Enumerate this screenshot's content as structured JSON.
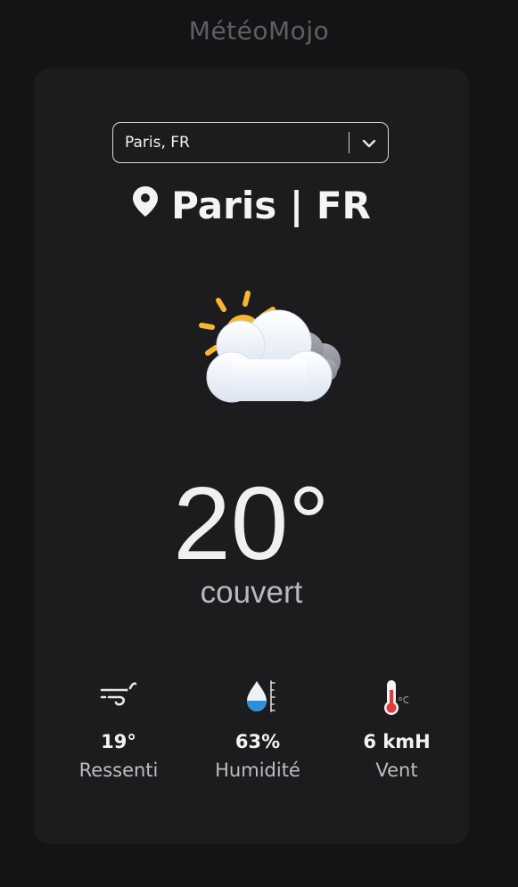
{
  "app": {
    "title": "MétéoMojo"
  },
  "city_select": {
    "value": "Paris, FR"
  },
  "location": {
    "text": "Paris | FR"
  },
  "current": {
    "temperature": "20°",
    "description": "couvert",
    "icon": "sun-behind-clouds-icon"
  },
  "stats": [
    {
      "value": "19°",
      "label": "Ressenti",
      "icon": "wind-icon"
    },
    {
      "value": "63%",
      "label": "Humidité",
      "icon": "humidity-drop-icon"
    },
    {
      "value": "6 kmH",
      "label": "Vent",
      "icon": "thermometer-icon"
    }
  ],
  "colors": {
    "background": "#141416",
    "card": "#1c1c1f",
    "sun": "#f7b731",
    "drop": "#2f8fd8",
    "thermometer": "#e03a3a"
  }
}
